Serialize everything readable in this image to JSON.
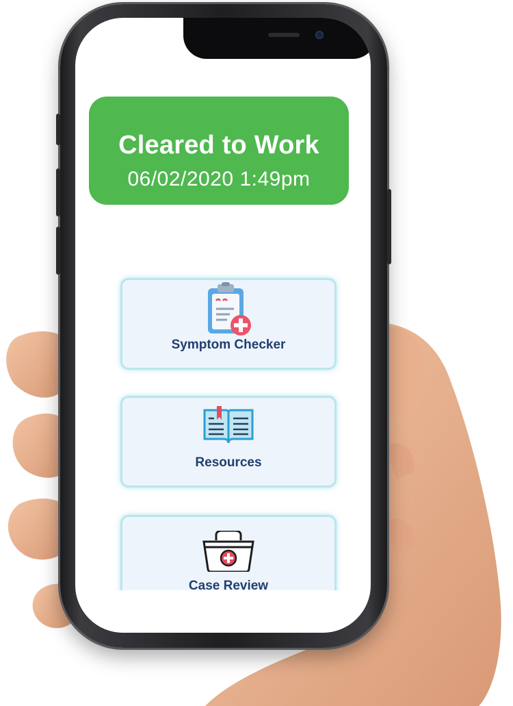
{
  "status": {
    "title": "Cleared to Work",
    "timestamp": "06/02/2020 1:49pm",
    "color": "#4fb84f"
  },
  "menu": [
    {
      "label": "Symptom Checker",
      "icon": "clipboard-medical-icon"
    },
    {
      "label": "Resources",
      "icon": "open-book-icon"
    },
    {
      "label": "Case Review",
      "icon": "medical-basket-icon"
    }
  ]
}
